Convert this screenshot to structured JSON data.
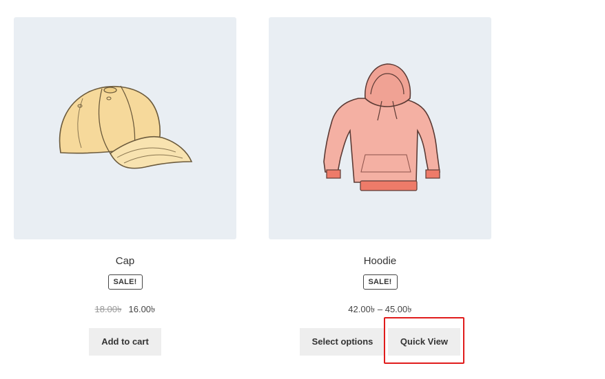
{
  "products": [
    {
      "title": "Cap",
      "badge": "SALE!",
      "price_old": "18.00৳",
      "price_new": "16.00৳",
      "button_label": "Add to cart",
      "image_icon": "cap-image"
    },
    {
      "title": "Hoodie",
      "badge": "SALE!",
      "price_range": "42.00৳ – 45.00৳",
      "button_label": "Select options",
      "quick_view_label": "Quick View",
      "image_icon": "hoodie-image"
    }
  ],
  "colors": {
    "thumb_bg": "#e9eef3",
    "button_bg": "#eeeeee",
    "highlight": "#e01b1b"
  }
}
